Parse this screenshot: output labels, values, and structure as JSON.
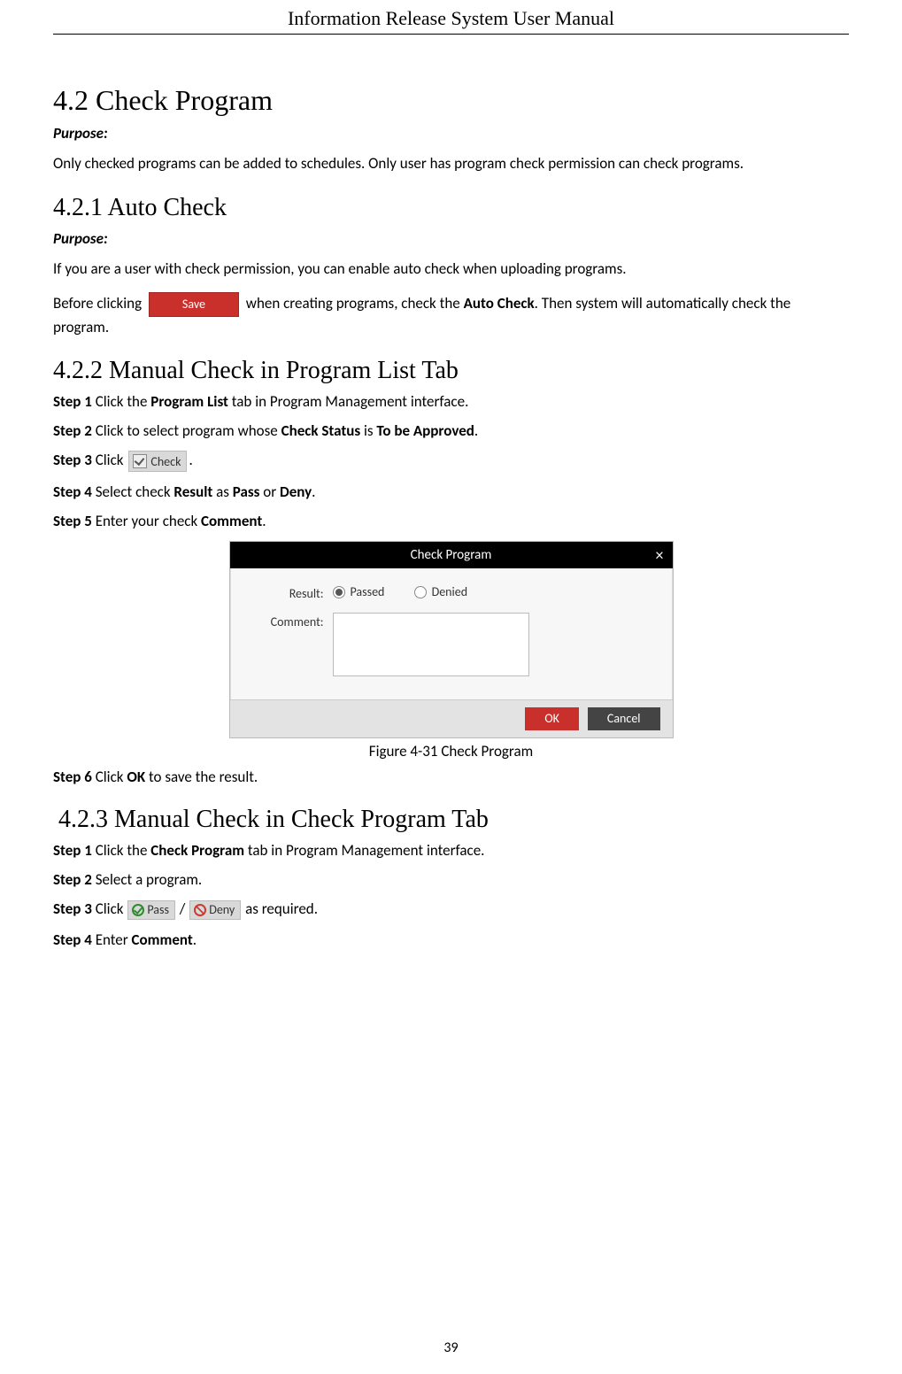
{
  "header": {
    "title": "Information Release System User Manual"
  },
  "page_number": "39",
  "s42": {
    "heading": "4.2 Check Program",
    "purpose_label": "Purpose:",
    "purpose_text": "Only checked programs can be added to schedules. Only user has program check permission can check programs."
  },
  "s421": {
    "heading": "4.2.1 Auto Check",
    "purpose_label": "Purpose:",
    "purpose_text": "If you are a user with check permission, you can enable auto check when uploading programs.",
    "para_before": "Before clicking ",
    "save_label": "Save",
    "para_mid": " when creating programs, check the ",
    "auto_check_bold": "Auto Check",
    "para_after": ". Then system will automatically check the program."
  },
  "s422": {
    "heading": "4.2.2 Manual Check in Program List Tab",
    "step1": {
      "num": "Step 1",
      "a": " Click the ",
      "b1": "Program List",
      "c": " tab in Program Management interface."
    },
    "step2": {
      "num": "Step 2",
      "a": " Click to select program whose ",
      "b1": "Check Status",
      "c": " is ",
      "b2": "To be Approved",
      "d": "."
    },
    "step3": {
      "num": "Step 3",
      "a": " Click ",
      "check_label": "Check",
      "b": "."
    },
    "step4": {
      "num": "Step 4",
      "a": " Select check ",
      "b1": "Result",
      "c": " as ",
      "b2": "Pass",
      "d": " or ",
      "b3": "Deny",
      "e": "."
    },
    "step5": {
      "num": "Step 5",
      "a": " Enter your check ",
      "b1": "Comment",
      "c": "."
    },
    "step6": {
      "num": "Step 6",
      "a": " Click ",
      "b1": "OK",
      "c": " to save the result."
    },
    "figure_caption": "Figure 4-31 Check Program"
  },
  "dialog": {
    "title": "Check Program",
    "close": "×",
    "result_label": "Result:",
    "passed": "Passed",
    "denied": "Denied",
    "comment_label": "Comment:",
    "ok": "OK",
    "cancel": "Cancel"
  },
  "s423": {
    "heading": "4.2.3 Manual Check in Check Program Tab",
    "step1": {
      "num": "Step 1",
      "a": " Click the ",
      "b1": "Check Program",
      "c": " tab in Program Management interface."
    },
    "step2": {
      "num": "Step 2",
      "a": " Select a program."
    },
    "step3": {
      "num": "Step 3",
      "a": " Click ",
      "pass_label": "Pass",
      "sep1": " / ",
      "deny_label": "Deny",
      "b": " as required."
    },
    "step4": {
      "num": "Step 4",
      "a": " Enter ",
      "b1": "Comment",
      "c": "."
    }
  }
}
